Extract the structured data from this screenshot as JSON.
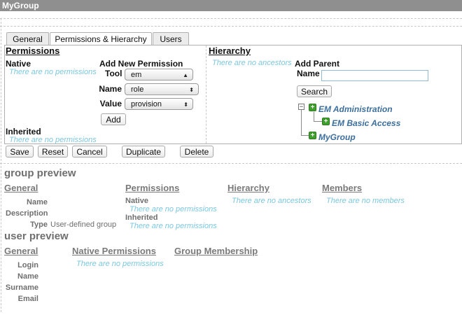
{
  "window": {
    "title": "MyGroup"
  },
  "tabs": [
    {
      "label": "General"
    },
    {
      "label": "Permissions & Hierarchy"
    },
    {
      "label": "Users"
    }
  ],
  "permissions": {
    "title": "Permissions",
    "native_label": "Native",
    "native_empty": "There are no permissions",
    "inherited_label": "Inherited",
    "inherited_empty": "There are no permissions",
    "add_new": {
      "title": "Add New Permission",
      "tool_label": "Tool",
      "tool_value": "em",
      "name_label": "Name",
      "name_value": "role",
      "value_label": "Value",
      "value_value": "provision",
      "add_button": "Add"
    }
  },
  "hierarchy": {
    "title": "Hierarchy",
    "ancestors_empty": "There are no ancestors",
    "add_parent_title": "Add Parent",
    "name_label": "Name",
    "name_value": "",
    "search_button": "Search",
    "tree": [
      "EM Administration",
      "EM Basic Access",
      "MyGroup"
    ]
  },
  "actions": {
    "save": "Save",
    "reset": "Reset",
    "cancel": "Cancel",
    "duplicate": "Duplicate",
    "delete": "Delete"
  },
  "group_preview": {
    "title": "group preview",
    "general_title": "General",
    "name_label": "Name",
    "description_label": "Description",
    "type_label": "Type",
    "type_value": "User-defined group",
    "permissions_title": "Permissions",
    "native_label": "Native",
    "native_empty": "There are no permissions",
    "inherited_label": "Inherited",
    "inherited_empty": "There are no permissions",
    "hierarchy_title": "Hierarchy",
    "hierarchy_empty": "There are no ancestors",
    "members_title": "Members",
    "members_empty": "There are no members"
  },
  "user_preview": {
    "title": "user preview",
    "general_title": "General",
    "login_label": "Login",
    "name_label": "Name",
    "surname_label": "Surname",
    "email_label": "Email",
    "native_permissions_title": "Native Permissions",
    "native_permissions_empty": "There are no permissions",
    "group_membership_title": "Group Membership"
  }
}
